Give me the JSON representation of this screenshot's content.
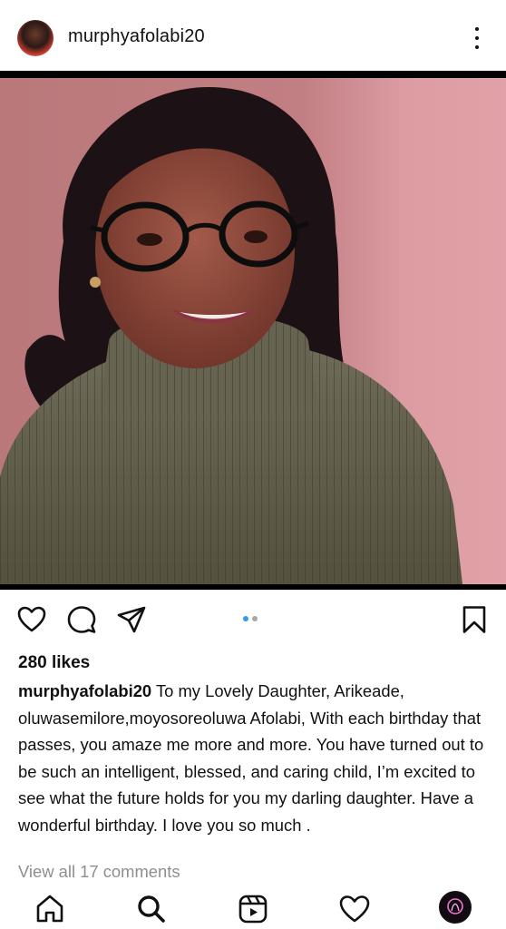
{
  "post": {
    "username": "murphyafolabi20",
    "likes": "280 likes",
    "caption_user": "murphyafolabi20",
    "caption_text": " To my Lovely Daughter, Arikeade, oluwasemilore,moyosoreoluwa Afolabi, With each birthday that passes, you amaze me more and more. You have turned out to be such an intelligent, blessed,  and caring child, I’m excited to see what the future holds for you my darling daughter. Have a wonderful birthday. I love you so much .",
    "view_comments": "View all 17 comments"
  },
  "carousel": {
    "total": 2,
    "active_index": 0,
    "active_color": "#3897f0",
    "inactive_color": "#a8a8a8"
  },
  "icons": {
    "header_menu": "more-vertical-icon",
    "like": "heart-icon",
    "comment": "comment-bubble-icon",
    "share": "paper-plane-icon",
    "save": "bookmark-icon",
    "nav": [
      "home-icon",
      "search-icon",
      "reels-icon",
      "heart-icon",
      "profile-avatar"
    ]
  }
}
